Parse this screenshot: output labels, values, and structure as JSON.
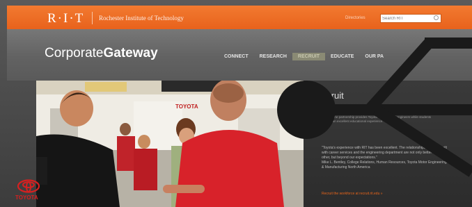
{
  "header": {
    "logo": "R·I·T",
    "institution": "Rochester Institute of Technology",
    "top_link": "Directories",
    "search_placeholder": "Search RIT"
  },
  "nav": {
    "brand_light": "Corporate",
    "brand_bold": "Gateway",
    "items": [
      {
        "label": "CONNECT",
        "active": false
      },
      {
        "label": "RESEARCH",
        "active": false
      },
      {
        "label": "RECRUIT",
        "active": true
      },
      {
        "label": "EDUCATE",
        "active": false
      },
      {
        "label": "OUR PA",
        "active": false
      }
    ]
  },
  "hero": {
    "panel_title": "ecruit",
    "panel_body": "Toyota. The partnership provides Toyota with talented engineers while students receive an excellent educational experience.",
    "quote": "\"Toyota's experience with RIT has been excellent. The relationships we have built with career services and the engineering department are not only better than any other, but beyond our expectations.\"",
    "quote_attribution": "Mike L. Bentley, College Relations, Human Resources, Toyota Motor Engineering & Manufacturing North America",
    "link": "Recruit the workforce at recruit.rit.edu »",
    "banner_brand": "TOYOTA"
  },
  "colors": {
    "accent": "#e8651a",
    "toyota_red": "#d62020"
  }
}
